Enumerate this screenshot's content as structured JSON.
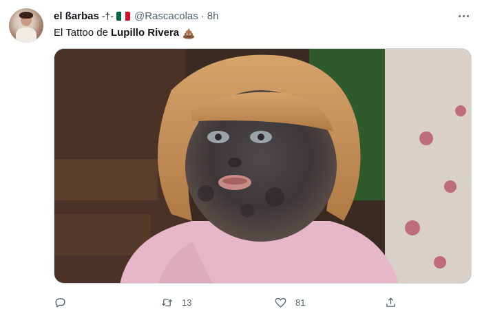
{
  "tweet": {
    "author_name": "el ßarbas",
    "dagger_glyph": "-†-",
    "handle": "@Rascacolas",
    "separator": "·",
    "time": "8h",
    "text_prefix": "El Tattoo de",
    "text_bold": "Lupillo Rivera"
  },
  "flag_colors": [
    "#006847",
    "#ffffff",
    "#ce1126"
  ],
  "actions": {
    "reply_count": "",
    "retweet_count": "13",
    "like_count": "81"
  },
  "icons": {
    "reply": "reply-icon",
    "retweet": "retweet-icon",
    "like": "heart-icon",
    "share": "share-icon",
    "more": "more-icon",
    "emoji": "pile-of-poo-emoji"
  }
}
